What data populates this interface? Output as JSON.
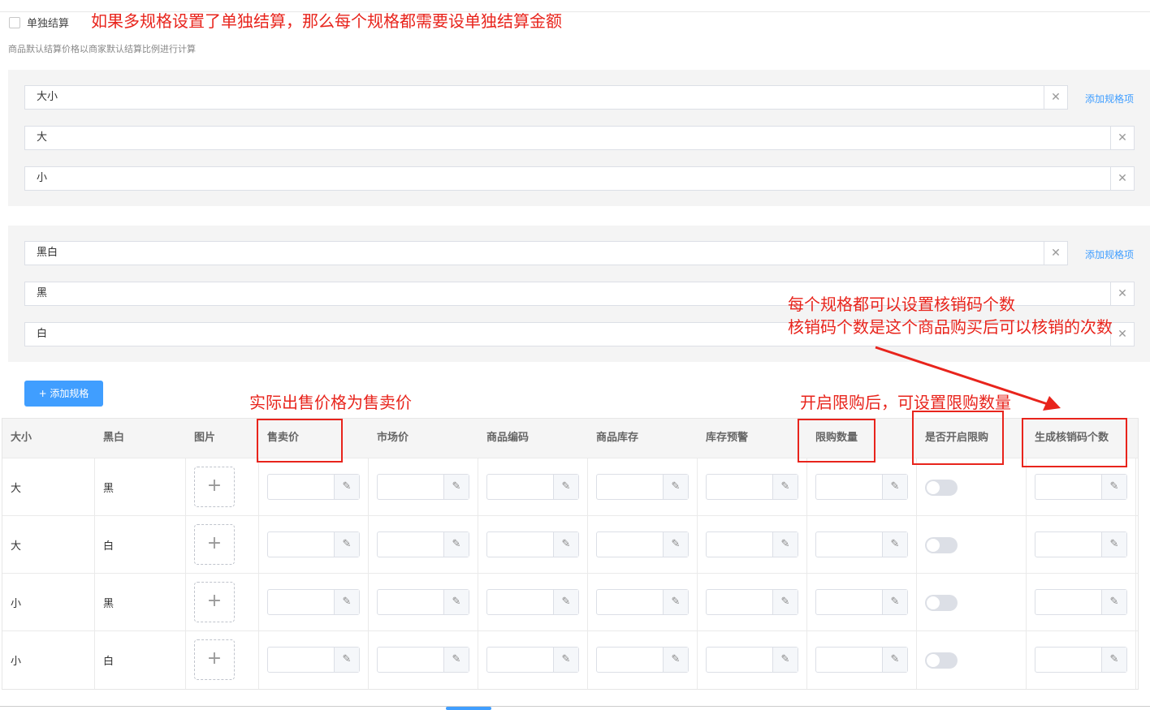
{
  "settlement": {
    "checkbox_label": "单独结算",
    "hint": "商品默认结算价格以商家默认结算比例进行计算"
  },
  "annotations": {
    "settlement_note": "如果多规格设置了单独结算，那么每个规格都需要设单独结算金额",
    "price_note": "实际出售价格为售卖价",
    "limit_note": "开启限购后，可设置限购数量",
    "verify_note_line1": "每个规格都可以设置核销码个数",
    "verify_note_line2": "核销码个数是这个商品购买后可以核销的次数"
  },
  "spec_groups": [
    {
      "name": "大小",
      "values": [
        "大",
        "小"
      ],
      "add_item_label": "添加规格项"
    },
    {
      "name": "黑白",
      "values": [
        "黑",
        "白"
      ],
      "add_item_label": "添加规格项"
    }
  ],
  "add_spec_button": "+ 添加规格",
  "table": {
    "headers": [
      "大小",
      "黑白",
      "图片",
      "售卖价",
      "市场价",
      "商品编码",
      "商品库存",
      "库存预警",
      "限购数量",
      "是否开启限购",
      "生成核销码个数"
    ],
    "rows": [
      {
        "size": "大",
        "color": "黑",
        "limit_enabled": false
      },
      {
        "size": "大",
        "color": "白",
        "limit_enabled": false
      },
      {
        "size": "小",
        "color": "黑",
        "limit_enabled": false
      },
      {
        "size": "小",
        "color": "白",
        "limit_enabled": false
      }
    ]
  },
  "icons": {
    "remove": "close-icon",
    "upload": "plus-icon",
    "edit": "pencil-icon"
  },
  "colors": {
    "accent": "#409eff",
    "annotation": "#e8241c"
  }
}
